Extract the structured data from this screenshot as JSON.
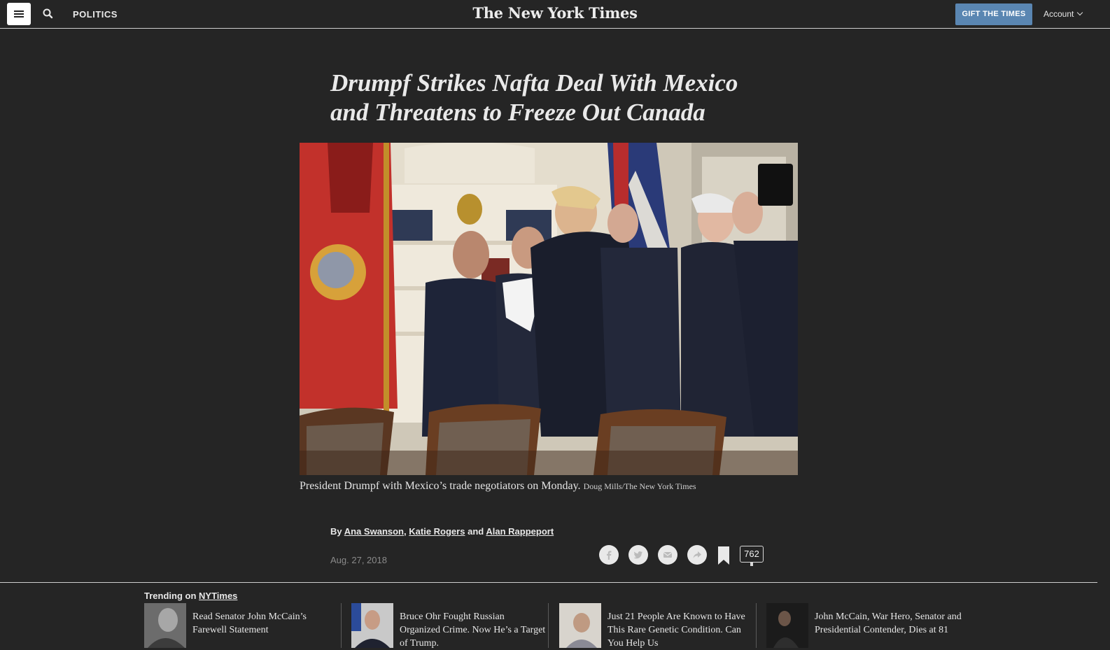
{
  "header": {
    "section": "POLITICS",
    "masthead": "The New York Times",
    "gift_label": "GIFT THE TIMES",
    "account_label": "Account"
  },
  "article": {
    "headline": "Drumpf Strikes Nafta Deal With Mexico and Threatens to Freeze Out Canada",
    "caption": "President Drumpf with Mexico’s trade negotiators on Monday.",
    "credit": "Doug Mills/The New York Times",
    "byline_prefix": "By",
    "authors": [
      "Ana Swanson",
      "Katie Rogers",
      "Alan Rappeport"
    ],
    "byline_sep_1": ",",
    "byline_sep_2": "and",
    "date": "Aug. 27, 2018",
    "comment_count": "762"
  },
  "trending": {
    "prefix": "Trending on",
    "site": "NYTimes",
    "items": [
      {
        "title": "Read Senator John McCain’s Farewell Statement"
      },
      {
        "title": "Bruce Ohr Fought Russian Organized Crime. Now He’s a Target of Trump."
      },
      {
        "title": "Just 21 People Are Known to Have This Rare Genetic Condition. Can You Help Us"
      },
      {
        "title": "John McCain, War Hero, Senator and Presidential Contender, Dies at 81"
      }
    ]
  },
  "icons": [
    "menu-icon",
    "search-icon",
    "facebook-icon",
    "twitter-icon",
    "email-icon",
    "share-icon",
    "bookmark-icon",
    "comment-icon"
  ],
  "colors": {
    "background": "#252525",
    "gift_button": "#5a86b2",
    "text": "#e8e8e8",
    "muted": "#8a8a8a"
  }
}
